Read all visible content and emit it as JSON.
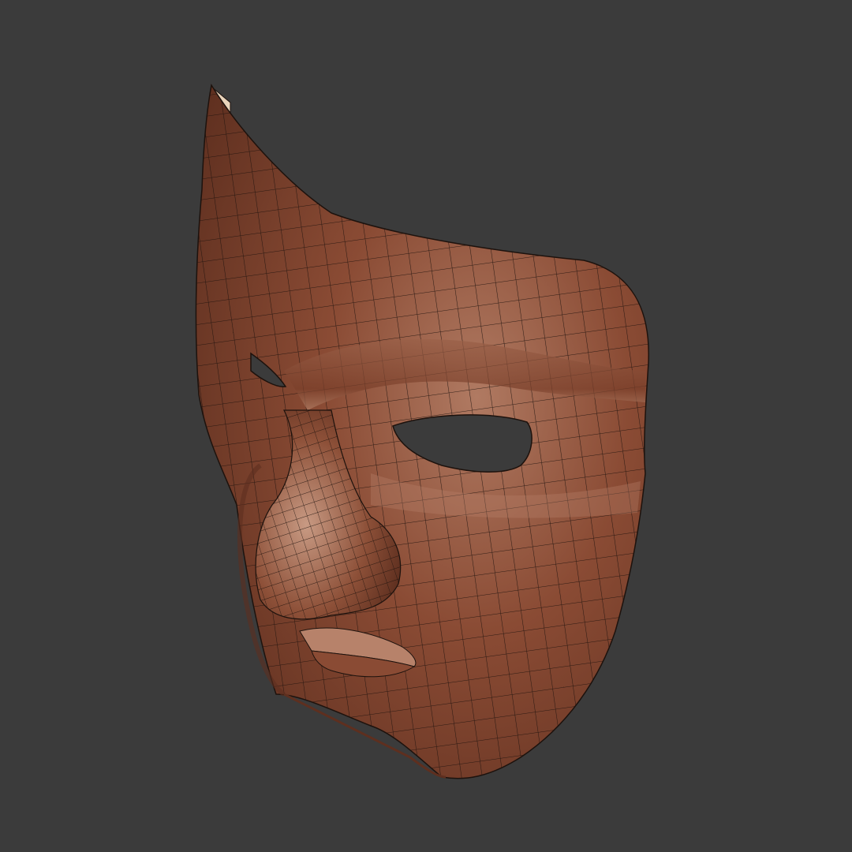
{
  "scene": {
    "subject": "mask-wireframe-render",
    "colors": {
      "background": "#3b3b3b",
      "mask_base": "#8a4b34",
      "mask_light": "#b7826a",
      "mask_dark": "#5e2f1f",
      "inner_face": "#e9d4bb",
      "wire": "#1d120d",
      "eye_hole": "#3b3b3b"
    }
  }
}
